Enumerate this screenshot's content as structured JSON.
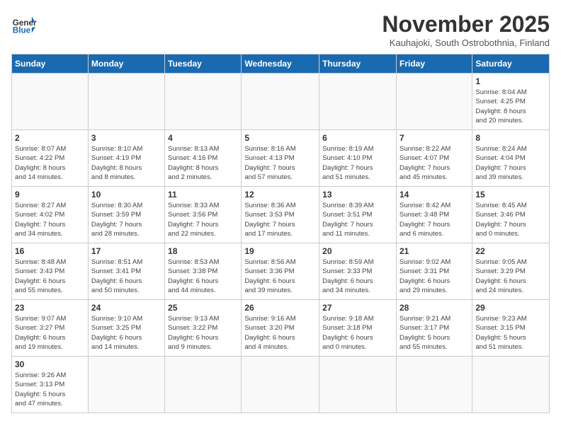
{
  "header": {
    "logo_general": "General",
    "logo_blue": "Blue",
    "month_title": "November 2025",
    "location": "Kauhajoki, South Ostrobothnia, Finland"
  },
  "weekdays": [
    "Sunday",
    "Monday",
    "Tuesday",
    "Wednesday",
    "Thursday",
    "Friday",
    "Saturday"
  ],
  "weeks": [
    [
      {
        "day": "",
        "info": ""
      },
      {
        "day": "",
        "info": ""
      },
      {
        "day": "",
        "info": ""
      },
      {
        "day": "",
        "info": ""
      },
      {
        "day": "",
        "info": ""
      },
      {
        "day": "",
        "info": ""
      },
      {
        "day": "1",
        "info": "Sunrise: 8:04 AM\nSunset: 4:25 PM\nDaylight: 8 hours\nand 20 minutes."
      }
    ],
    [
      {
        "day": "2",
        "info": "Sunrise: 8:07 AM\nSunset: 4:22 PM\nDaylight: 8 hours\nand 14 minutes."
      },
      {
        "day": "3",
        "info": "Sunrise: 8:10 AM\nSunset: 4:19 PM\nDaylight: 8 hours\nand 8 minutes."
      },
      {
        "day": "4",
        "info": "Sunrise: 8:13 AM\nSunset: 4:16 PM\nDaylight: 8 hours\nand 2 minutes."
      },
      {
        "day": "5",
        "info": "Sunrise: 8:16 AM\nSunset: 4:13 PM\nDaylight: 7 hours\nand 57 minutes."
      },
      {
        "day": "6",
        "info": "Sunrise: 8:19 AM\nSunset: 4:10 PM\nDaylight: 7 hours\nand 51 minutes."
      },
      {
        "day": "7",
        "info": "Sunrise: 8:22 AM\nSunset: 4:07 PM\nDaylight: 7 hours\nand 45 minutes."
      },
      {
        "day": "8",
        "info": "Sunrise: 8:24 AM\nSunset: 4:04 PM\nDaylight: 7 hours\nand 39 minutes."
      }
    ],
    [
      {
        "day": "9",
        "info": "Sunrise: 8:27 AM\nSunset: 4:02 PM\nDaylight: 7 hours\nand 34 minutes."
      },
      {
        "day": "10",
        "info": "Sunrise: 8:30 AM\nSunset: 3:59 PM\nDaylight: 7 hours\nand 28 minutes."
      },
      {
        "day": "11",
        "info": "Sunrise: 8:33 AM\nSunset: 3:56 PM\nDaylight: 7 hours\nand 22 minutes."
      },
      {
        "day": "12",
        "info": "Sunrise: 8:36 AM\nSunset: 3:53 PM\nDaylight: 7 hours\nand 17 minutes."
      },
      {
        "day": "13",
        "info": "Sunrise: 8:39 AM\nSunset: 3:51 PM\nDaylight: 7 hours\nand 11 minutes."
      },
      {
        "day": "14",
        "info": "Sunrise: 8:42 AM\nSunset: 3:48 PM\nDaylight: 7 hours\nand 6 minutes."
      },
      {
        "day": "15",
        "info": "Sunrise: 8:45 AM\nSunset: 3:46 PM\nDaylight: 7 hours\nand 0 minutes."
      }
    ],
    [
      {
        "day": "16",
        "info": "Sunrise: 8:48 AM\nSunset: 3:43 PM\nDaylight: 6 hours\nand 55 minutes."
      },
      {
        "day": "17",
        "info": "Sunrise: 8:51 AM\nSunset: 3:41 PM\nDaylight: 6 hours\nand 50 minutes."
      },
      {
        "day": "18",
        "info": "Sunrise: 8:53 AM\nSunset: 3:38 PM\nDaylight: 6 hours\nand 44 minutes."
      },
      {
        "day": "19",
        "info": "Sunrise: 8:56 AM\nSunset: 3:36 PM\nDaylight: 6 hours\nand 39 minutes."
      },
      {
        "day": "20",
        "info": "Sunrise: 8:59 AM\nSunset: 3:33 PM\nDaylight: 6 hours\nand 34 minutes."
      },
      {
        "day": "21",
        "info": "Sunrise: 9:02 AM\nSunset: 3:31 PM\nDaylight: 6 hours\nand 29 minutes."
      },
      {
        "day": "22",
        "info": "Sunrise: 9:05 AM\nSunset: 3:29 PM\nDaylight: 6 hours\nand 24 minutes."
      }
    ],
    [
      {
        "day": "23",
        "info": "Sunrise: 9:07 AM\nSunset: 3:27 PM\nDaylight: 6 hours\nand 19 minutes."
      },
      {
        "day": "24",
        "info": "Sunrise: 9:10 AM\nSunset: 3:25 PM\nDaylight: 6 hours\nand 14 minutes."
      },
      {
        "day": "25",
        "info": "Sunrise: 9:13 AM\nSunset: 3:22 PM\nDaylight: 6 hours\nand 9 minutes."
      },
      {
        "day": "26",
        "info": "Sunrise: 9:16 AM\nSunset: 3:20 PM\nDaylight: 6 hours\nand 4 minutes."
      },
      {
        "day": "27",
        "info": "Sunrise: 9:18 AM\nSunset: 3:18 PM\nDaylight: 6 hours\nand 0 minutes."
      },
      {
        "day": "28",
        "info": "Sunrise: 9:21 AM\nSunset: 3:17 PM\nDaylight: 5 hours\nand 55 minutes."
      },
      {
        "day": "29",
        "info": "Sunrise: 9:23 AM\nSunset: 3:15 PM\nDaylight: 5 hours\nand 51 minutes."
      }
    ],
    [
      {
        "day": "30",
        "info": "Sunrise: 9:26 AM\nSunset: 3:13 PM\nDaylight: 5 hours\nand 47 minutes."
      },
      {
        "day": "",
        "info": ""
      },
      {
        "day": "",
        "info": ""
      },
      {
        "day": "",
        "info": ""
      },
      {
        "day": "",
        "info": ""
      },
      {
        "day": "",
        "info": ""
      },
      {
        "day": "",
        "info": ""
      }
    ]
  ]
}
